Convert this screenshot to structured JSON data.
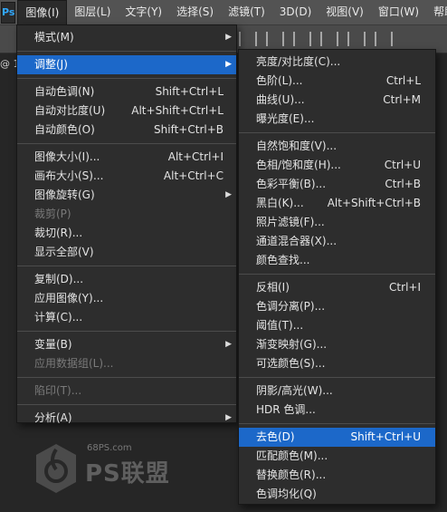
{
  "menubar": {
    "logo": "Ps",
    "items": [
      {
        "label": "图像(I)",
        "active": true
      },
      {
        "label": "图层(L)"
      },
      {
        "label": "文字(Y)"
      },
      {
        "label": "选择(S)"
      },
      {
        "label": "滤镜(T)"
      },
      {
        "label": "3D(D)"
      },
      {
        "label": "视图(V)"
      },
      {
        "label": "窗口(W)"
      },
      {
        "label": "帮助"
      }
    ]
  },
  "doc_tab_stub": "@ 1",
  "image_menu": {
    "items": [
      {
        "label": "模式(M)",
        "submenu": true
      },
      {
        "sep": true
      },
      {
        "label": "调整(J)",
        "submenu": true,
        "highlight": true
      },
      {
        "sep": true
      },
      {
        "label": "自动色调(N)",
        "shortcut": "Shift+Ctrl+L"
      },
      {
        "label": "自动对比度(U)",
        "shortcut": "Alt+Shift+Ctrl+L"
      },
      {
        "label": "自动颜色(O)",
        "shortcut": "Shift+Ctrl+B"
      },
      {
        "sep": true
      },
      {
        "label": "图像大小(I)...",
        "shortcut": "Alt+Ctrl+I"
      },
      {
        "label": "画布大小(S)...",
        "shortcut": "Alt+Ctrl+C"
      },
      {
        "label": "图像旋转(G)",
        "submenu": true
      },
      {
        "label": "裁剪(P)",
        "disabled": true
      },
      {
        "label": "裁切(R)..."
      },
      {
        "label": "显示全部(V)"
      },
      {
        "sep": true
      },
      {
        "label": "复制(D)..."
      },
      {
        "label": "应用图像(Y)..."
      },
      {
        "label": "计算(C)..."
      },
      {
        "sep": true
      },
      {
        "label": "变量(B)",
        "submenu": true
      },
      {
        "label": "应用数据组(L)...",
        "disabled": true
      },
      {
        "sep": true
      },
      {
        "label": "陷印(T)...",
        "disabled": true
      },
      {
        "sep": true
      },
      {
        "label": "分析(A)",
        "submenu": true
      }
    ]
  },
  "adjust_menu": {
    "items": [
      {
        "label": "亮度/对比度(C)..."
      },
      {
        "label": "色阶(L)...",
        "shortcut": "Ctrl+L"
      },
      {
        "label": "曲线(U)...",
        "shortcut": "Ctrl+M"
      },
      {
        "label": "曝光度(E)..."
      },
      {
        "sep": true
      },
      {
        "label": "自然饱和度(V)..."
      },
      {
        "label": "色相/饱和度(H)...",
        "shortcut": "Ctrl+U"
      },
      {
        "label": "色彩平衡(B)...",
        "shortcut": "Ctrl+B"
      },
      {
        "label": "黑白(K)...",
        "shortcut": "Alt+Shift+Ctrl+B"
      },
      {
        "label": "照片滤镜(F)..."
      },
      {
        "label": "通道混合器(X)..."
      },
      {
        "label": "颜色查找..."
      },
      {
        "sep": true
      },
      {
        "label": "反相(I)",
        "shortcut": "Ctrl+I"
      },
      {
        "label": "色调分离(P)..."
      },
      {
        "label": "阈值(T)..."
      },
      {
        "label": "渐变映射(G)..."
      },
      {
        "label": "可选颜色(S)..."
      },
      {
        "sep": true
      },
      {
        "label": "阴影/高光(W)..."
      },
      {
        "label": "HDR 色调..."
      },
      {
        "sep": true
      },
      {
        "label": "去色(D)",
        "shortcut": "Shift+Ctrl+U",
        "highlight": true
      },
      {
        "label": "匹配颜色(M)..."
      },
      {
        "label": "替换颜色(R)..."
      },
      {
        "label": "色调均化(Q)"
      }
    ]
  },
  "watermark": {
    "url": "68PS.com",
    "text": "PS联盟"
  },
  "colors": {
    "highlight": "#1c68c9",
    "menu_bg": "#2d2d2d",
    "menubar_bg": "#535353"
  }
}
